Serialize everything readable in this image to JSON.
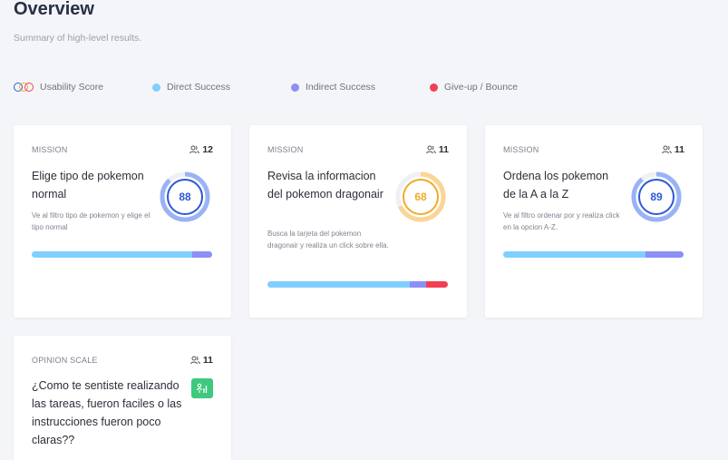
{
  "header": {
    "title": "Overview",
    "subtitle": "Summary of high-level results."
  },
  "legend": {
    "usability": "Usability Score",
    "direct": "Direct Success",
    "indirect": "Indirect Success",
    "giveup": "Give-up / Bounce"
  },
  "colors": {
    "direct": "#7fcfff",
    "indirect": "#8c8ff5",
    "giveup": "#f23f55",
    "score_blue": "#2c5ad8",
    "score_blue_ring": "#9ab3f5",
    "score_orange": "#f0ab2a",
    "score_orange_ring": "#fad594",
    "opinion_green": "#3ec97e"
  },
  "cards": [
    {
      "type": "MISSION",
      "count": "12",
      "title": "Elige tipo de pokemon normal",
      "description": "Ve al filtro tipo de pokemon y elige el tipo normal",
      "score": "88",
      "score_fraction": 0.88,
      "bar": {
        "direct": 0.89,
        "indirect": 0.11,
        "giveup": 0
      }
    },
    {
      "type": "MISSION",
      "count": "11",
      "title": "Revisa la informacion del pokemon dragonair",
      "description": "Busca la tarjeta del pokemon dragonair y realiza un click sobre ella.",
      "score": "68",
      "score_fraction": 0.68,
      "bar": {
        "direct": 0.79,
        "indirect": 0.09,
        "giveup": 0.12
      }
    },
    {
      "type": "MISSION",
      "count": "11",
      "title": "Ordena los pokemon de la A a la Z",
      "description": "Ve al filtro ordenar por y realiza click en la opcion A-Z.",
      "score": "89",
      "score_fraction": 0.89,
      "bar": {
        "direct": 0.79,
        "indirect": 0.21,
        "giveup": 0
      }
    },
    {
      "type": "OPINION SCALE",
      "count": "11",
      "title": "¿Como te sentiste realizando las tareas, fueron faciles o las instrucciones fueron poco claras??",
      "icon": "opinion-scale-icon"
    }
  ]
}
